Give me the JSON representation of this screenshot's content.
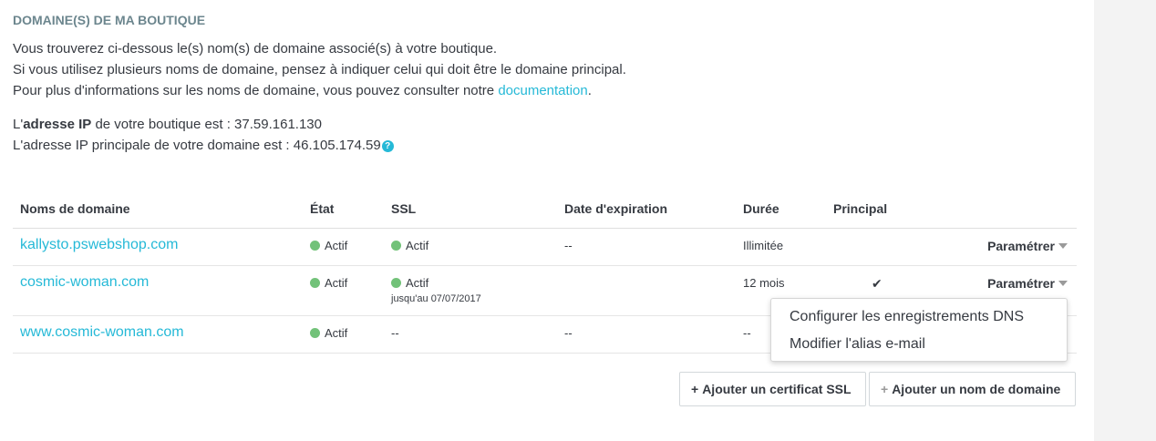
{
  "section_title": "DOMAINE(S) DE MA BOUTIQUE",
  "intro": {
    "line1": "Vous trouverez ci-dessous le(s) nom(s) de domaine associé(s) à votre boutique.",
    "line2": "Si vous utilisez plusieurs noms de domaine, pensez à indiquer celui qui doit être le domaine principal.",
    "line3_prefix": "Pour plus d'informations sur les noms de domaine, vous pouvez consulter notre ",
    "line3_link": "documentation",
    "line3_suffix": "."
  },
  "ip": {
    "line1_prefix": "L'",
    "line1_bold": "adresse IP",
    "line1_rest": " de votre boutique est : 37.59.161.130",
    "line2": "L'adresse IP principale de votre domaine est : 46.105.174.59",
    "help_icon": "?"
  },
  "table": {
    "headers": [
      "Noms de domaine",
      "État",
      "SSL",
      "Date d'expiration",
      "Durée",
      "Principal"
    ],
    "rows": [
      {
        "domain": "kallysto.pswebshop.com",
        "state": "Actif",
        "ssl": "Actif",
        "ssl_sub": "",
        "expiration": "--",
        "duration": "Illimitée",
        "principal": "",
        "action": "Paramétrer"
      },
      {
        "domain": "cosmic-woman.com",
        "state": "Actif",
        "ssl": "Actif",
        "ssl_sub": "jusqu'au 07/07/2017",
        "expiration": "",
        "duration": "12 mois",
        "principal": "✔",
        "action": "Paramétrer"
      },
      {
        "domain": "www.cosmic-woman.com",
        "state": "Actif",
        "ssl": "--",
        "ssl_sub": "",
        "expiration": "--",
        "duration": "--",
        "principal": "",
        "action": ""
      }
    ]
  },
  "dropdown": {
    "items": [
      "Configurer les enregistrements DNS",
      "Modifier l'alias e-mail"
    ]
  },
  "buttons": {
    "add_ssl": "Ajouter un certificat SSL",
    "add_domain": "Ajouter un nom de domaine",
    "plus": "+"
  },
  "colors": {
    "link": "#25b9d7",
    "status_active": "#72c279"
  }
}
